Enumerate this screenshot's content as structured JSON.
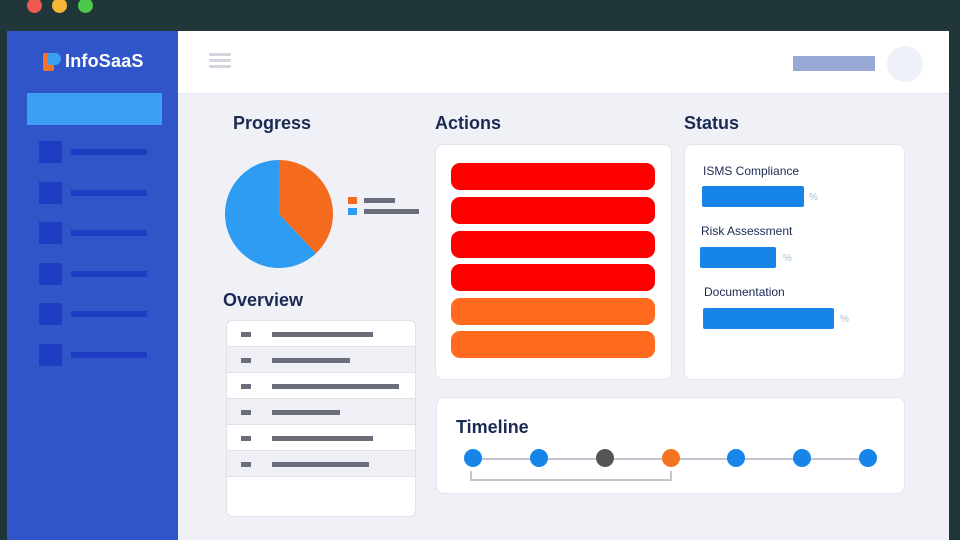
{
  "app": {
    "name": "InfoSaaS"
  },
  "colors": {
    "sidebar": "#2f55c9",
    "sidebar_active": "#3b9ff3",
    "pie_orange": "#f46b1e",
    "pie_blue": "#2e9cf3",
    "action_red": "#ff0000",
    "action_orange": "#ff6a1e",
    "status_bar": "#1784e8",
    "timeline_blue": "#1784e8",
    "timeline_gray": "#555555",
    "timeline_orange": "#f4731e"
  },
  "sidebar": {
    "active_index": 0,
    "item_icon": "square-icon",
    "item_count": 6
  },
  "header": {
    "menu_icon": "hamburger-menu-icon",
    "avatar_icon": "user-avatar"
  },
  "sections": {
    "progress": "Progress",
    "overview": "Overview",
    "actions": "Actions",
    "status": "Status",
    "timeline": "Timeline"
  },
  "progress": {
    "slices": [
      {
        "color": "#f46b1e",
        "fraction": 0.38
      },
      {
        "color": "#2e9cf3",
        "fraction": 0.62
      }
    ]
  },
  "actions": {
    "buttons": [
      {
        "color": "#ff0000"
      },
      {
        "color": "#ff0000"
      },
      {
        "color": "#ff0000"
      },
      {
        "color": "#ff0000"
      },
      {
        "color": "#ff6a1e"
      },
      {
        "color": "#ff6a1e"
      }
    ]
  },
  "status": {
    "items": [
      {
        "label": "ISMS Compliance",
        "pct": "%"
      },
      {
        "label": "Risk Assessment",
        "pct": "%"
      },
      {
        "label": "Documentation",
        "pct": "%"
      }
    ]
  },
  "timeline": {
    "nodes": [
      {
        "state": "blue"
      },
      {
        "state": "blue"
      },
      {
        "state": "gray"
      },
      {
        "state": "orange"
      },
      {
        "state": "blue"
      },
      {
        "state": "blue"
      },
      {
        "state": "blue"
      }
    ]
  }
}
